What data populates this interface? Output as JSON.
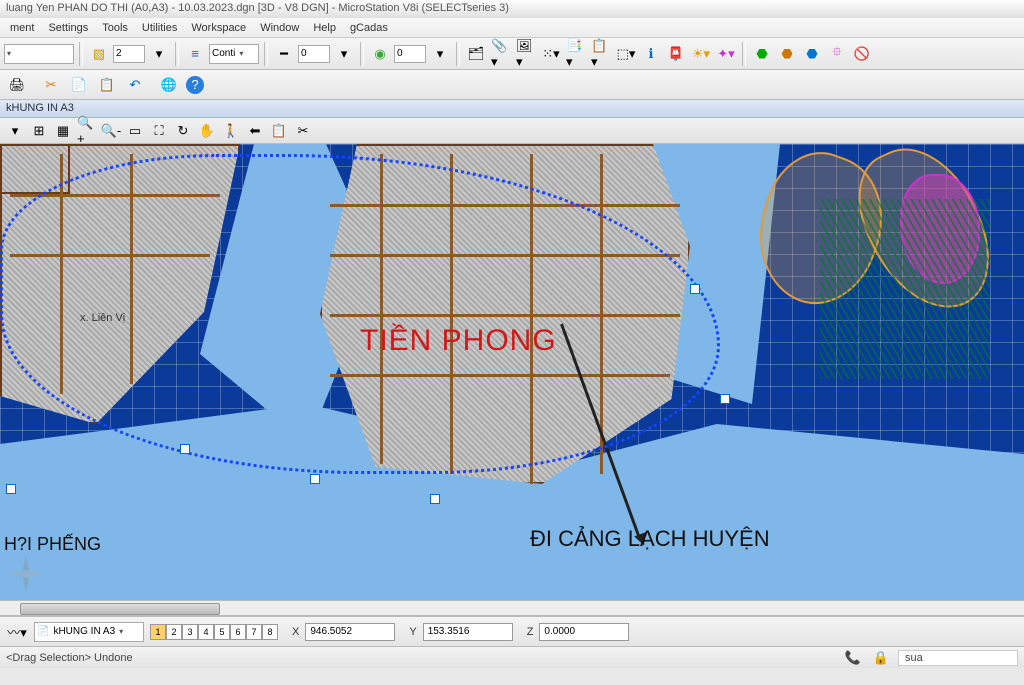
{
  "title": "luang Yen PHAN DO THI (A0,A3) - 10.03.2023.dgn [3D - V8 DGN] - MicroStation V8i (SELECTseries 3)",
  "menu": [
    "ment",
    "Settings",
    "Tools",
    "Utilities",
    "Workspace",
    "Window",
    "Help",
    "gCadas"
  ],
  "toolbar1": {
    "level_value": "2",
    "linestyle": "Conti",
    "weight": "0",
    "color": "0"
  },
  "view": {
    "header": "kHUNG IN A3"
  },
  "map_labels": {
    "lienvi": "x. Liên Vị",
    "tienphong": "TIỀN PHONG",
    "haipheng": "H?I PHẾNG",
    "dicang": "ĐI CẢNG LẠCH HUYỆN"
  },
  "bottom": {
    "combo": "kHUNG IN A3",
    "views": [
      "1",
      "2",
      "3",
      "4",
      "5",
      "6",
      "7",
      "8"
    ],
    "x_label": "X",
    "y_label": "Y",
    "z_label": "Z",
    "x": "946.5052",
    "y": "153.3516",
    "z": "0.0000"
  },
  "status": {
    "left": "<Drag Selection> Undone",
    "right": "sua"
  },
  "icons": {
    "new": "📄",
    "open": "📂",
    "save": "💾",
    "cut": "✂",
    "copy": "📋",
    "paste": "📄",
    "undo": "↶",
    "print": "🖨",
    "globe": "🌐",
    "help": "?",
    "layer": "📒",
    "grid": "▦",
    "fence": "▭",
    "select": "➤",
    "models": "🗂",
    "refs": "🔗",
    "raster": "🖼",
    "levelmgr": "📑",
    "keyin": "🔑",
    "info": "ℹ",
    "star": "✦",
    "sparkle": "✨",
    "dim": "📏",
    "cells": "⬚",
    "plus": "➕",
    "deny": "🚫",
    "db1": "🟩",
    "db2": "🟦",
    "db3": "🟨",
    "sun": "☀"
  }
}
